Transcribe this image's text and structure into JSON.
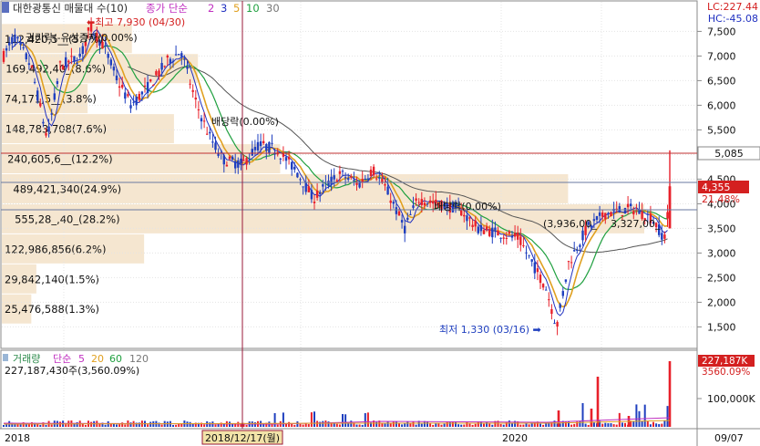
{
  "colors": {
    "up": "#e8202a",
    "down": "#1f3fbf",
    "ma2": "#c030c0",
    "ma3": "#2030c0",
    "ma5": "#e0a020",
    "ma10": "#20a040",
    "ma30": "#555555",
    "volume_profile": "#f5e6d0",
    "panel_border": "#8a8a8a",
    "price_line": "#c03030",
    "hover_line": "#9a1a3a",
    "label_current": "#d42020",
    "label_line": "#ffffff"
  },
  "header": {
    "stock_name": "대한광통신 매물대 수(10)",
    "ma_title": "종가 단순",
    "ma_periods": [
      "2",
      "3",
      "5",
      "10",
      "30"
    ],
    "lc": "LC:227.44",
    "hc": "HC:-45.08"
  },
  "volume_header": {
    "title": "거래량",
    "ma_title": "단순",
    "ma_periods": [
      "5",
      "20",
      "60",
      "120"
    ],
    "value": "227,187,430주(3,560.09%)"
  },
  "annotations": {
    "high": "최고 7,930 (04/30)",
    "low": "최저 1,330 (03/16)",
    "rights_ex": "권리락(-유상증자(0.00%)",
    "dividend_ex_1": "배당락(0.00%)",
    "dividend_ex_2": "배당락(0.00%)"
  },
  "price_labels": {
    "line": "5,085",
    "current": "4,355",
    "current_pct": "21.48%"
  },
  "volume_labels": {
    "current": "227,187K",
    "current_pct": "3560.09%"
  },
  "x_axis": {
    "ticks": [
      "2018",
      "2020",
      "09/07"
    ],
    "hover": "2018/12/17(월)"
  },
  "chart_data": {
    "type": "candlestick",
    "y_ticks": [
      7500,
      7000,
      6500,
      6000,
      5500,
      5000,
      4500,
      4000,
      3500,
      3000,
      2500,
      2000,
      1500
    ],
    "y_tick_labels": [
      "7,500",
      "7,000",
      "6,500",
      "6,000",
      "5,500",
      "5,000",
      "4,500",
      "4,000",
      "3,500",
      "3,000",
      "2,500",
      "2,000",
      "1,500"
    ],
    "ylim": [
      1100,
      8100
    ],
    "volume_tick_labels": [
      "100,000K"
    ],
    "volume_profile": [
      {
        "low": 7040,
        "high": 7650,
        "label": "112,420,5__(5.7%)",
        "value": 112420500
      },
      {
        "low": 6430,
        "high": 7040,
        "label": "169,492,40_(8.6%)",
        "value": 169492400
      },
      {
        "low": 5820,
        "high": 6430,
        "label": "74,171,5__(3.8%)",
        "value": 74171500
      },
      {
        "low": 5210,
        "high": 5820,
        "label": "148,783,708(7.6%)",
        "value": 148783708
      },
      {
        "low": 4600,
        "high": 5210,
        "label": "240,605,6__(12.2%)",
        "value": 240605600
      },
      {
        "low": 3990,
        "high": 4600,
        "label": "489,421,340(24.9%)",
        "value": 489421340
      },
      {
        "low": 3380,
        "high": 3990,
        "label": "555,28_,40_(28.2%)",
        "value": 555280400
      },
      {
        "low": 2770,
        "high": 3380,
        "label": "122,986,856(6.2%)",
        "value": 122986856
      },
      {
        "low": 2160,
        "high": 2770,
        "label": "29,842,140(1.5%)",
        "value": 29842140
      },
      {
        "low": 1550,
        "high": 2160,
        "label": "25,476,588(1.3%)",
        "value": 25476588
      }
    ],
    "overlay_labels": [
      "(3,936,00_",
      "3,327,00_"
    ]
  }
}
